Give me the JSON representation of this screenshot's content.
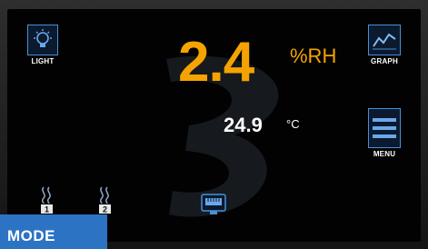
{
  "humidity": {
    "value": "2.4",
    "unit": "%RH",
    "color": "#f5a300"
  },
  "temperature": {
    "value": "24.9",
    "unit": "°C"
  },
  "buttons": {
    "light": {
      "label": "LIGHT",
      "icon": "light-bulb-icon"
    },
    "graph": {
      "label": "GRAPH",
      "icon": "line-graph-icon"
    },
    "menu": {
      "label": "MENU",
      "icon": "hamburger-menu-icon"
    },
    "probe1": {
      "label": "1",
      "icon": "heater-probe-icon"
    },
    "probe2": {
      "label": "2",
      "icon": "heater-probe-icon"
    },
    "network": {
      "icon": "ethernet-port-icon"
    },
    "mode": {
      "label": "MODE"
    }
  },
  "accent": "#4a8fd6"
}
